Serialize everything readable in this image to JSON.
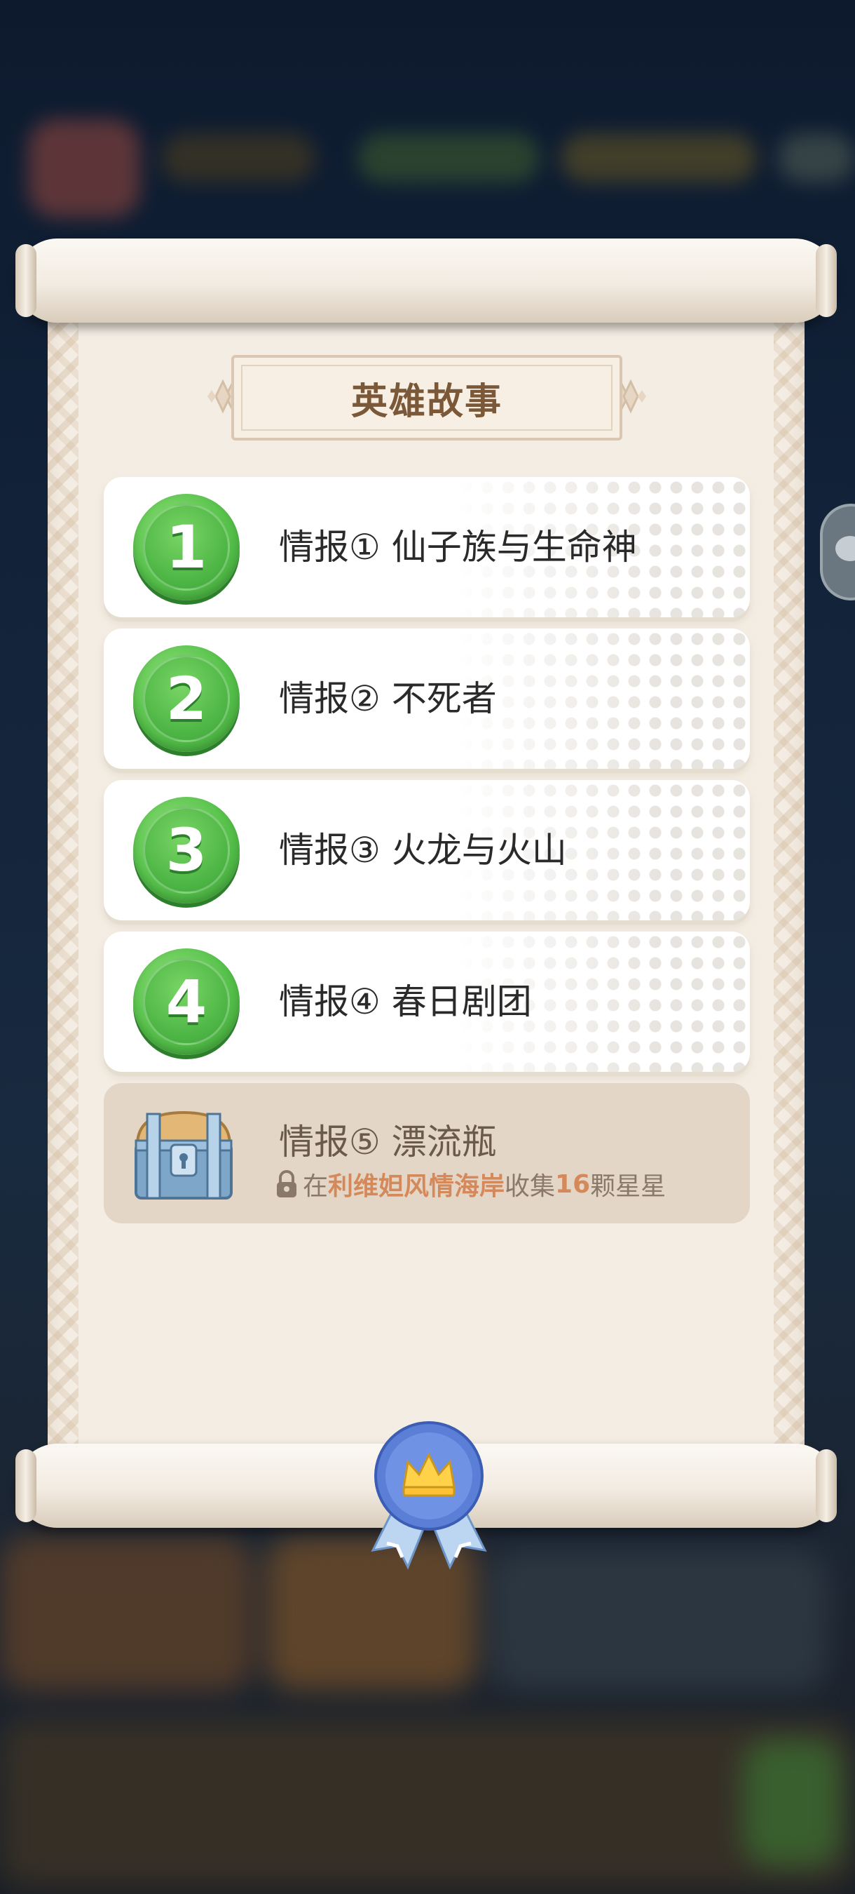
{
  "panel": {
    "title": "英雄故事"
  },
  "stories": [
    {
      "number": "1",
      "label": "情报① 仙子族与生命神"
    },
    {
      "number": "2",
      "label": "情报② 不死者"
    },
    {
      "number": "3",
      "label": "情报③ 火龙与火山"
    },
    {
      "number": "4",
      "label": "情报④ 春日剧团"
    }
  ],
  "locked_story": {
    "label": "情报⑤ 漂流瓶",
    "req_prefix": "在",
    "req_location": "利维妲风情海岸",
    "req_mid": "收集",
    "req_count": "16",
    "req_suffix": "颗星星"
  },
  "colors": {
    "badge_green": "#56c14a",
    "highlight_orange": "#d5895a",
    "title_brown": "#7a5838",
    "locked_bg": "#e3d6c6"
  },
  "icons": [
    "chest-icon",
    "lock-icon",
    "crown-medal-icon",
    "chat-icon"
  ]
}
